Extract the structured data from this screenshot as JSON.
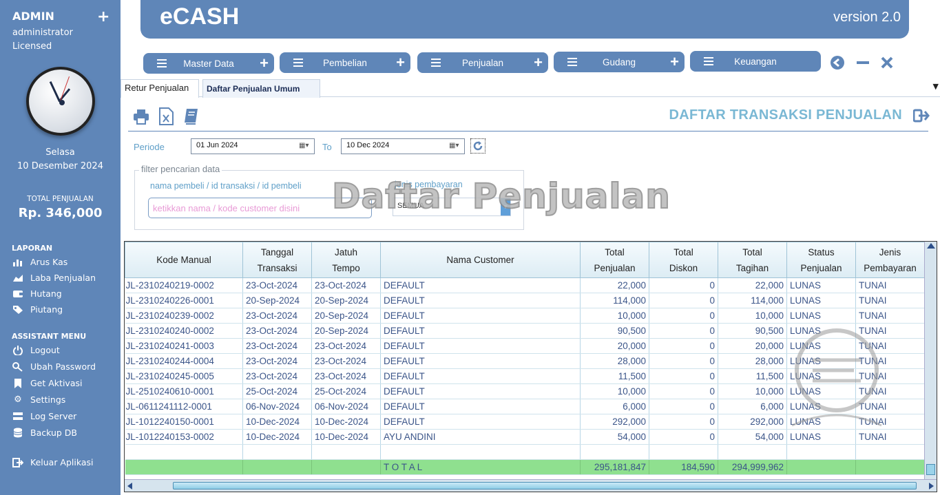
{
  "sidebar": {
    "user": "ADMIN",
    "role": "administrator",
    "license": "Licensed",
    "day": "Selasa",
    "date": "10 Desember 2024",
    "total_label": "TOTAL PENJUALAN",
    "total_value": "Rp. 346,000",
    "laporan_title": "LAPORAN",
    "laporan_items": [
      {
        "label": "Arus Kas",
        "icon": "bar-chart-icon"
      },
      {
        "label": "Laba Penjualan",
        "icon": "area-chart-icon"
      },
      {
        "label": "Hutang",
        "icon": "wallet-icon"
      },
      {
        "label": "Piutang",
        "icon": "tags-icon"
      }
    ],
    "assistant_title": "ASSISTANT MENU",
    "assistant_items": [
      {
        "label": "Logout",
        "icon": "power-icon"
      },
      {
        "label": "Ubah Password",
        "icon": "key-icon"
      },
      {
        "label": "Get Aktivasi",
        "icon": "bookmark-icon"
      },
      {
        "label": "Settings",
        "icon": "gear-icon"
      },
      {
        "label": "Log Server",
        "icon": "server-icon"
      },
      {
        "label": "Backup DB",
        "icon": "database-icon"
      }
    ],
    "exit_label": "Keluar Aplikasi"
  },
  "header": {
    "app_name": "eCASH",
    "version": "version 2.0"
  },
  "menu": [
    "Master Data",
    "Pembelian",
    "Penjualan",
    "Gudang",
    "Keuangan"
  ],
  "tabs": [
    {
      "label": "Retur Penjualan",
      "active": false
    },
    {
      "label": "Daftar Penjualan Umum",
      "active": true
    }
  ],
  "page": {
    "title": "DAFTAR TRANSAKSI PENJUALAN",
    "watermark": "Daftar Penjualan"
  },
  "period": {
    "label": "Periode",
    "from": "01 Jun  2024",
    "to_label": "To",
    "to": "10 Dec  2024"
  },
  "filter": {
    "legend": "filter pencarian data",
    "search_label": "nama pembeli / id transaksi / id pembeli",
    "search_placeholder": "ketikkan nama / kode customer disini",
    "payment_label": "jenis pembayaran",
    "payment_value": "SEMUA"
  },
  "table": {
    "headers": [
      [
        "Kode Manual"
      ],
      [
        "Tanggal",
        "Transaksi"
      ],
      [
        "Jatuh",
        "Tempo"
      ],
      [
        "Nama Customer"
      ],
      [
        "Total",
        "Penjualan"
      ],
      [
        "Total",
        "Diskon"
      ],
      [
        "Total",
        "Tagihan"
      ],
      [
        "Status",
        "Penjualan"
      ],
      [
        "Jenis",
        "Pembayaran"
      ]
    ],
    "rows": [
      [
        "JL-2310240219-0002",
        "23-Oct-2024",
        "23-Oct-2024",
        "DEFAULT",
        "22,000",
        "0",
        "22,000",
        "LUNAS",
        "TUNAI"
      ],
      [
        "JL-2310240226-0001",
        "20-Sep-2024",
        "20-Sep-2024",
        "DEFAULT",
        "114,000",
        "0",
        "114,000",
        "LUNAS",
        "TUNAI"
      ],
      [
        "JL-2310240239-0002",
        "23-Oct-2024",
        "20-Sep-2024",
        "DEFAULT",
        "10,000",
        "0",
        "10,000",
        "LUNAS",
        "TUNAI"
      ],
      [
        "JL-2310240240-0002",
        "23-Oct-2024",
        "20-Sep-2024",
        "DEFAULT",
        "90,500",
        "0",
        "90,500",
        "LUNAS",
        "TUNAI"
      ],
      [
        "JL-2310240241-0003",
        "23-Oct-2024",
        "23-Oct-2024",
        "DEFAULT",
        "20,000",
        "0",
        "20,000",
        "LUNAS",
        "TUNAI"
      ],
      [
        "JL-2310240244-0004",
        "23-Oct-2024",
        "23-Oct-2024",
        "DEFAULT",
        "28,000",
        "0",
        "28,000",
        "LUNAS",
        "TUNAI"
      ],
      [
        "JL-2310240245-0005",
        "23-Oct-2024",
        "23-Oct-2024",
        "DEFAULT",
        "11,500",
        "0",
        "11,500",
        "LUNAS",
        "TUNAI"
      ],
      [
        "JL-2510240610-0001",
        "25-Oct-2024",
        "25-Oct-2024",
        "DEFAULT",
        "10,000",
        "0",
        "10,000",
        "LUNAS",
        "TUNAI"
      ],
      [
        "JL-0611241112-0001",
        "06-Nov-2024",
        "06-Nov-2024",
        "DEFAULT",
        "6,000",
        "0",
        "6,000",
        "LUNAS",
        "TUNAI"
      ],
      [
        "JL-1012240150-0001",
        "10-Dec-2024",
        "10-Dec-2024",
        "DEFAULT",
        "292,000",
        "0",
        "292,000",
        "LUNAS",
        "TUNAI"
      ],
      [
        "JL-1012240153-0002",
        "10-Dec-2024",
        "10-Dec-2024",
        "AYU ANDINI",
        "54,000",
        "0",
        "54,000",
        "LUNAS",
        "TUNAI"
      ]
    ],
    "total": {
      "label": "T O T A L",
      "penjualan": "295,181,847",
      "diskon": "184,590",
      "tagihan": "294,999,962"
    }
  },
  "colors": {
    "sidebar": "#5f86b8",
    "title": "#7ab8d4",
    "total_row": "#8fe08f",
    "cell_text": "#3b5589"
  }
}
